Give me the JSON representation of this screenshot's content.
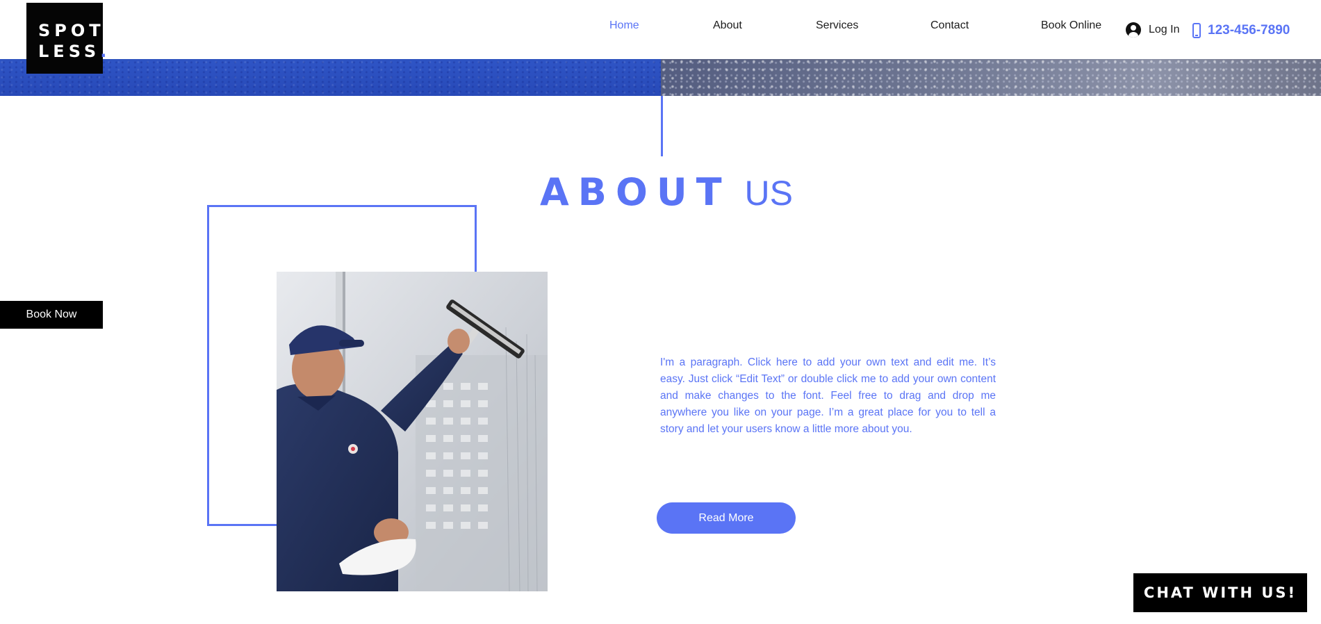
{
  "logo": {
    "line1": "SPOT",
    "line2": "LESS",
    "dot": "."
  },
  "nav": {
    "items": [
      {
        "label": "Home",
        "active": true
      },
      {
        "label": "About",
        "active": false
      },
      {
        "label": "Services",
        "active": false
      },
      {
        "label": "Contact",
        "active": false
      },
      {
        "label": "Book Online",
        "active": false
      }
    ],
    "login_label": "Log In",
    "phone": "123-456-7890"
  },
  "about": {
    "heading_bold": "ABOUT",
    "heading_light": "US",
    "paragraph": "I'm a paragraph. Click here to add your own text and edit me. It’s easy. Just click “Edit Text” or double click me to add your own content and make changes to the font. Feel free to drag and drop me anywhere you like on your page. I’m a great place for you to tell a story and let your users know a little more about you.",
    "read_more_label": "Read More"
  },
  "side": {
    "book_now_label": "Book Now"
  },
  "chat": {
    "label": "CHAT WITH US!"
  },
  "colors": {
    "accent": "#5a74f5",
    "dark": "#050505",
    "banner_blue": "#2c50c0"
  },
  "icons": {
    "user": "user-account-icon",
    "phone": "mobile-phone-icon"
  }
}
